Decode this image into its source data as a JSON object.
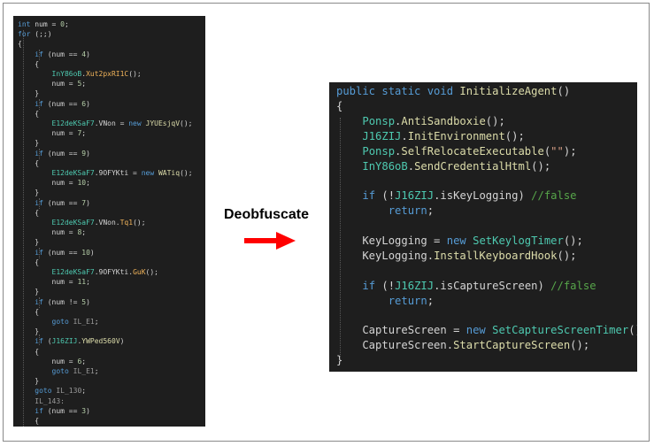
{
  "colors": {
    "panel_bg": "#1e1e1e",
    "keyword": "#569cd6",
    "type": "#4ec9b0",
    "method": "#dcdcaa",
    "method_obf": "#f0b35a",
    "label": "#9a9a9a",
    "comment": "#57a64a",
    "string": "#d69d85",
    "plain": "#d4d4d4",
    "arrow": "#ff0000"
  },
  "diagram": {
    "transform_label": "Deobfuscate",
    "obfuscated_code": [
      [
        [
          "kw",
          "int"
        ],
        [
          "pl",
          " num = "
        ],
        [
          "num",
          "0"
        ],
        [
          "pl",
          ";"
        ]
      ],
      [
        [
          "kw",
          "for"
        ],
        [
          "pl",
          " (;;)"
        ]
      ],
      [
        [
          "pl",
          "{"
        ]
      ],
      [
        [
          "pl",
          "    "
        ],
        [
          "kw",
          "if"
        ],
        [
          "pl",
          " (num == "
        ],
        [
          "num",
          "4"
        ],
        [
          "pl",
          ")"
        ]
      ],
      [
        [
          "pl",
          "    {"
        ]
      ],
      [
        [
          "pl",
          "        "
        ],
        [
          "ty",
          "InY86oB"
        ],
        [
          "pl",
          "."
        ],
        [
          "fn2",
          "Xut2pxRI1C"
        ],
        [
          "pl",
          "();"
        ]
      ],
      [
        [
          "pl",
          "        num = "
        ],
        [
          "num",
          "5"
        ],
        [
          "pl",
          ";"
        ]
      ],
      [
        [
          "pl",
          "    }"
        ]
      ],
      [
        [
          "pl",
          "    "
        ],
        [
          "kw",
          "if"
        ],
        [
          "pl",
          " (num == "
        ],
        [
          "num",
          "6"
        ],
        [
          "pl",
          ")"
        ]
      ],
      [
        [
          "pl",
          "    {"
        ]
      ],
      [
        [
          "pl",
          "        "
        ],
        [
          "ty",
          "E12deKSaF7"
        ],
        [
          "pl",
          ".VNon = "
        ],
        [
          "kw",
          "new"
        ],
        [
          "pl",
          " "
        ],
        [
          "fn",
          "JYUEsjqV"
        ],
        [
          "pl",
          "();"
        ]
      ],
      [
        [
          "pl",
          "        num = "
        ],
        [
          "num",
          "7"
        ],
        [
          "pl",
          ";"
        ]
      ],
      [
        [
          "pl",
          "    }"
        ]
      ],
      [
        [
          "pl",
          "    "
        ],
        [
          "kw",
          "if"
        ],
        [
          "pl",
          " (num == "
        ],
        [
          "num",
          "9"
        ],
        [
          "pl",
          ")"
        ]
      ],
      [
        [
          "pl",
          "    {"
        ]
      ],
      [
        [
          "pl",
          "        "
        ],
        [
          "ty",
          "E12deKSaF7"
        ],
        [
          "pl",
          ".9OFYKti = "
        ],
        [
          "kw",
          "new"
        ],
        [
          "pl",
          " "
        ],
        [
          "fn",
          "WATiq"
        ],
        [
          "pl",
          "();"
        ]
      ],
      [
        [
          "pl",
          "        num = "
        ],
        [
          "num",
          "10"
        ],
        [
          "pl",
          ";"
        ]
      ],
      [
        [
          "pl",
          "    }"
        ]
      ],
      [
        [
          "pl",
          "    "
        ],
        [
          "kw",
          "if"
        ],
        [
          "pl",
          " (num == "
        ],
        [
          "num",
          "7"
        ],
        [
          "pl",
          ")"
        ]
      ],
      [
        [
          "pl",
          "    {"
        ]
      ],
      [
        [
          "pl",
          "        "
        ],
        [
          "ty",
          "E12deKSaF7"
        ],
        [
          "pl",
          ".VNon."
        ],
        [
          "fn2",
          "Tq1"
        ],
        [
          "pl",
          "();"
        ]
      ],
      [
        [
          "pl",
          "        num = "
        ],
        [
          "num",
          "8"
        ],
        [
          "pl",
          ";"
        ]
      ],
      [
        [
          "pl",
          "    }"
        ]
      ],
      [
        [
          "pl",
          "    "
        ],
        [
          "kw",
          "if"
        ],
        [
          "pl",
          " (num == "
        ],
        [
          "num",
          "10"
        ],
        [
          "pl",
          ")"
        ]
      ],
      [
        [
          "pl",
          "    {"
        ]
      ],
      [
        [
          "pl",
          "        "
        ],
        [
          "ty",
          "E12deKSaF7"
        ],
        [
          "pl",
          ".9OFYKti."
        ],
        [
          "fn2",
          "GuK"
        ],
        [
          "pl",
          "();"
        ]
      ],
      [
        [
          "pl",
          "        num = "
        ],
        [
          "num",
          "11"
        ],
        [
          "pl",
          ";"
        ]
      ],
      [
        [
          "pl",
          "    }"
        ]
      ],
      [
        [
          "pl",
          "    "
        ],
        [
          "kw",
          "if"
        ],
        [
          "pl",
          " (num != "
        ],
        [
          "num",
          "5"
        ],
        [
          "pl",
          ")"
        ]
      ],
      [
        [
          "pl",
          "    {"
        ]
      ],
      [
        [
          "pl",
          "        "
        ],
        [
          "kw",
          "goto"
        ],
        [
          "pl",
          " "
        ],
        [
          "lbl",
          "IL_E1"
        ],
        [
          "pl",
          ";"
        ]
      ],
      [
        [
          "pl",
          "    }"
        ]
      ],
      [
        [
          "pl",
          "    "
        ],
        [
          "kw",
          "if"
        ],
        [
          "pl",
          " ("
        ],
        [
          "ty",
          "J16ZIJ"
        ],
        [
          "pl",
          "."
        ],
        [
          "fn",
          "YWPed560V"
        ],
        [
          "pl",
          ")"
        ]
      ],
      [
        [
          "pl",
          "    {"
        ]
      ],
      [
        [
          "pl",
          "        num = "
        ],
        [
          "num",
          "6"
        ],
        [
          "pl",
          ";"
        ]
      ],
      [
        [
          "pl",
          "        "
        ],
        [
          "kw",
          "goto"
        ],
        [
          "pl",
          " "
        ],
        [
          "lbl",
          "IL_E1"
        ],
        [
          "pl",
          ";"
        ]
      ],
      [
        [
          "pl",
          "    }"
        ]
      ],
      [
        [
          "pl",
          "    "
        ],
        [
          "kw",
          "goto"
        ],
        [
          "pl",
          " "
        ],
        [
          "lbl",
          "IL_130"
        ],
        [
          "pl",
          ";"
        ]
      ],
      [
        [
          "pl",
          "    "
        ],
        [
          "lbl",
          "IL_143:"
        ]
      ],
      [
        [
          "pl",
          "    "
        ],
        [
          "kw",
          "if"
        ],
        [
          "pl",
          " (num == "
        ],
        [
          "num",
          "3"
        ],
        [
          "pl",
          ")"
        ]
      ],
      [
        [
          "pl",
          "    {"
        ]
      ]
    ],
    "deobfuscated_code": [
      [
        [
          "kw",
          "public static void"
        ],
        [
          "pl",
          " "
        ],
        [
          "fn",
          "InitializeAgent"
        ],
        [
          "pl",
          "()"
        ]
      ],
      [
        [
          "pl",
          "{"
        ]
      ],
      [
        [
          "pl",
          "    "
        ],
        [
          "ty",
          "Ponsp"
        ],
        [
          "pl",
          "."
        ],
        [
          "fn",
          "AntiSandboxie"
        ],
        [
          "pl",
          "();"
        ]
      ],
      [
        [
          "pl",
          "    "
        ],
        [
          "ty",
          "J16ZIJ"
        ],
        [
          "pl",
          "."
        ],
        [
          "fn",
          "InitEnvironment"
        ],
        [
          "pl",
          "();"
        ]
      ],
      [
        [
          "pl",
          "    "
        ],
        [
          "ty",
          "Ponsp"
        ],
        [
          "pl",
          "."
        ],
        [
          "fn",
          "SelfRelocateExecutable"
        ],
        [
          "pl",
          "("
        ],
        [
          "str",
          "\"\""
        ],
        [
          "pl",
          ");"
        ]
      ],
      [
        [
          "pl",
          "    "
        ],
        [
          "ty",
          "InY86oB"
        ],
        [
          "pl",
          "."
        ],
        [
          "fn",
          "SendCredentialHtml"
        ],
        [
          "pl",
          "();"
        ]
      ],
      [
        [
          "pl",
          ""
        ]
      ],
      [
        [
          "pl",
          "    "
        ],
        [
          "kw",
          "if"
        ],
        [
          "pl",
          " (!"
        ],
        [
          "ty",
          "J16ZIJ"
        ],
        [
          "pl",
          ".isKeyLogging) "
        ],
        [
          "cm",
          "//false"
        ]
      ],
      [
        [
          "pl",
          "        "
        ],
        [
          "kw",
          "return"
        ],
        [
          "pl",
          ";"
        ]
      ],
      [
        [
          "pl",
          ""
        ]
      ],
      [
        [
          "pl",
          "    KeyLogging = "
        ],
        [
          "kw",
          "new"
        ],
        [
          "pl",
          " "
        ],
        [
          "ty",
          "SetKeylogTimer"
        ],
        [
          "pl",
          "();"
        ]
      ],
      [
        [
          "pl",
          "    KeyLogging."
        ],
        [
          "fn",
          "InstallKeyboardHook"
        ],
        [
          "pl",
          "();"
        ]
      ],
      [
        [
          "pl",
          ""
        ]
      ],
      [
        [
          "pl",
          "    "
        ],
        [
          "kw",
          "if"
        ],
        [
          "pl",
          " (!"
        ],
        [
          "ty",
          "J16ZIJ"
        ],
        [
          "pl",
          ".isCaptureScreen) "
        ],
        [
          "cm",
          "//false"
        ]
      ],
      [
        [
          "pl",
          "        "
        ],
        [
          "kw",
          "return"
        ],
        [
          "pl",
          ";"
        ]
      ],
      [
        [
          "pl",
          ""
        ]
      ],
      [
        [
          "pl",
          "    CaptureScreen = "
        ],
        [
          "kw",
          "new"
        ],
        [
          "pl",
          " "
        ],
        [
          "ty",
          "SetCaptureScreenTimer"
        ],
        [
          "pl",
          "();"
        ]
      ],
      [
        [
          "pl",
          "    CaptureScreen."
        ],
        [
          "fn",
          "StartCaptureScreen"
        ],
        [
          "pl",
          "();"
        ]
      ],
      [
        [
          "pl",
          "}"
        ]
      ]
    ]
  }
}
